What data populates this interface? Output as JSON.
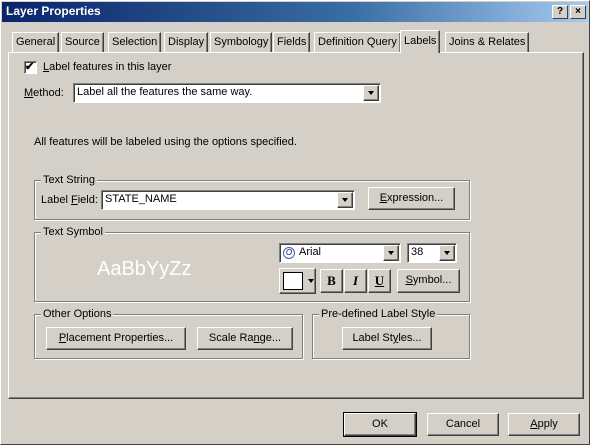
{
  "window": {
    "title": "Layer Properties"
  },
  "titlebar_buttons": {
    "help": "?",
    "close": "×"
  },
  "tabs": [
    {
      "label": "General"
    },
    {
      "label": "Source"
    },
    {
      "label": "Selection"
    },
    {
      "label": "Display"
    },
    {
      "label": "Symbology"
    },
    {
      "label": "Fields"
    },
    {
      "label": "Definition Query"
    },
    {
      "label": "Labels"
    },
    {
      "label": "Joins & Relates"
    }
  ],
  "active_tab": "Labels",
  "label_checkbox": {
    "label_pre": "",
    "label_ul": "L",
    "label_post": "abel features in this layer",
    "checked": true,
    "glyph": "✔"
  },
  "method": {
    "label_pre": "",
    "label_ul": "M",
    "label_post": "ethod:",
    "value": "Label all the features the same way."
  },
  "info_text": "All features will be labeled using the options specified.",
  "text_string": {
    "group_label": "Text String",
    "field_label_pre": "Label ",
    "field_label_ul": "F",
    "field_label_post": "ield:",
    "field_value": "STATE_NAME",
    "expression_pre": "",
    "expression_ul": "E",
    "expression_post": "xpression..."
  },
  "text_symbol": {
    "group_label": "Text Symbol",
    "preview": "AaBbYyZz",
    "font": "Arial",
    "font_icon": "O",
    "size": "38",
    "bold": "B",
    "italic": "I",
    "underline": "U",
    "symbol_pre": "",
    "symbol_ul": "S",
    "symbol_post": "ymbol..."
  },
  "other_options": {
    "group_label": "Other Options",
    "placement_pre": "",
    "placement_ul": "P",
    "placement_post": "lacement Properties...",
    "scale_pre": "Scale Ra",
    "scale_ul": "n",
    "scale_post": "ge..."
  },
  "predefined": {
    "group_label": "Pre-defined Label Style",
    "styles_pre": "Label St",
    "styles_ul": "y",
    "styles_post": "les..."
  },
  "footer": {
    "ok": "OK",
    "cancel": "Cancel",
    "apply_pre": "",
    "apply_ul": "A",
    "apply_post": "pply"
  },
  "colors": {
    "title_start": "#0a246a",
    "title_end": "#a6caf0",
    "face": "#d4d0c8",
    "preview_text": "#ffffff"
  }
}
